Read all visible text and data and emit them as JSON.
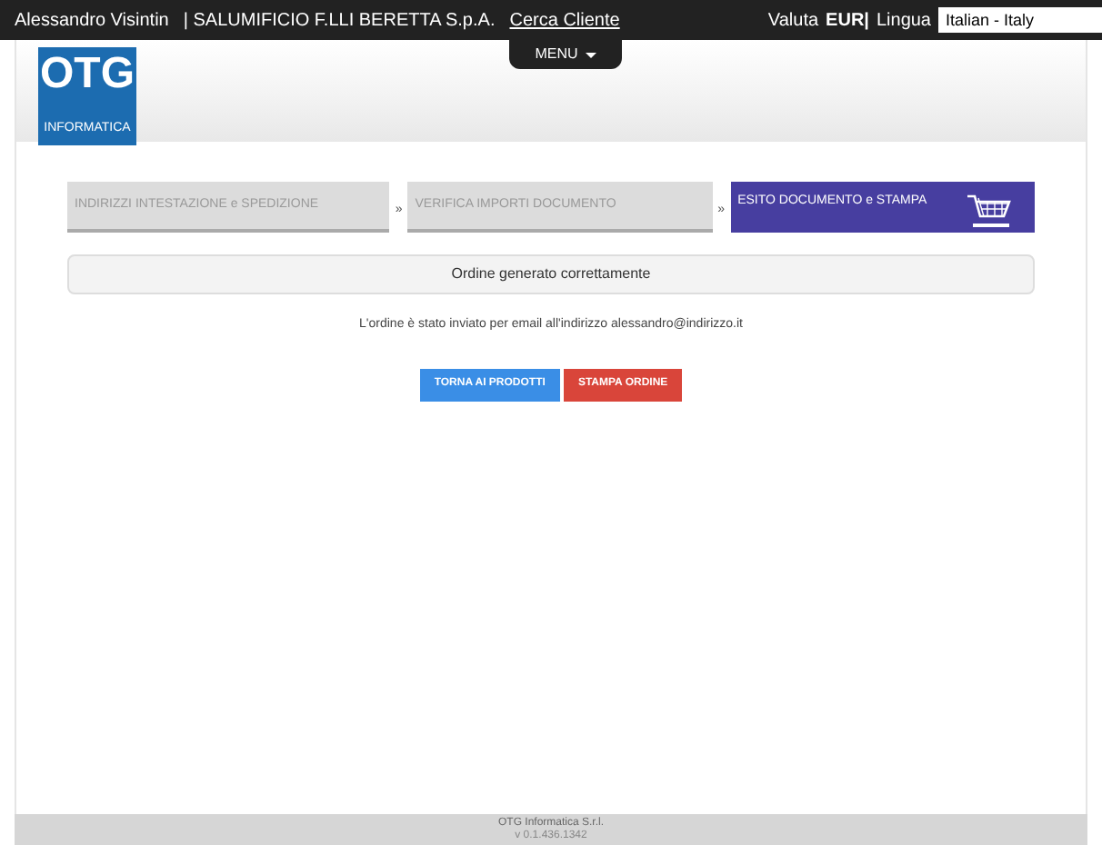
{
  "top_bar": {
    "user": "Alessandro Visintin",
    "company": "| SALUMIFICIO F.LLI BERETTA S.p.A.",
    "link": "Cerca Cliente",
    "currency_label": "Valuta",
    "currency": "EUR|",
    "language_label": "Lingua",
    "language": "Italian - Italy"
  },
  "logo": {
    "title": "OTG",
    "subtitle": "INFORMATICA"
  },
  "menu": {
    "label": "MENU"
  },
  "steps": [
    {
      "label": "INDIRIZZI INTESTAZIONE e SPEDIZIONE",
      "selected": false
    },
    {
      "label": "VERIFICA IMPORTI DOCUMENTO",
      "selected": false,
      "separator": "»"
    },
    {
      "label": "ESITO DOCUMENTO e STAMPA",
      "selected": true,
      "separator": "»"
    }
  ],
  "status": "Ordine generato correttamente",
  "message": "L'ordine è stato inviato per email all'indirizzo alessandro@indirizzo.it",
  "buttons": [
    {
      "label": "TORNA AI PRODOTTI",
      "kind": "primary"
    },
    {
      "label": "STAMPA ORDINE",
      "kind": "danger"
    }
  ],
  "footer": {
    "company": "OTG Informatica S.r.l.",
    "version": "v 0.1.436.1342"
  }
}
